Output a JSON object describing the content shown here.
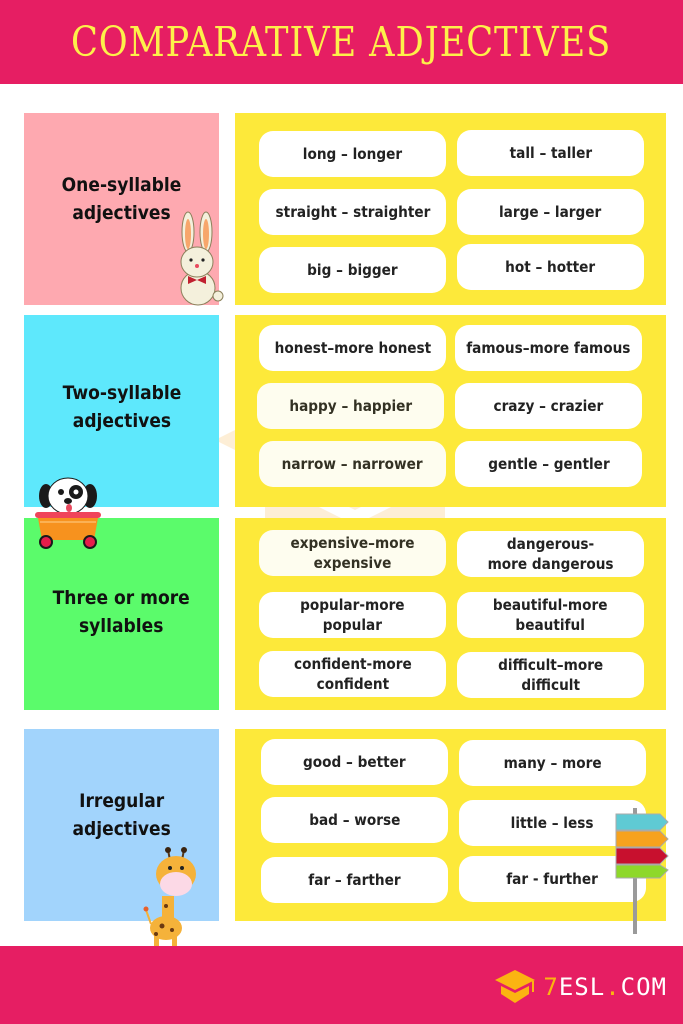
{
  "header": {
    "title": "COMPARATIVE ADJECTIVES"
  },
  "colors": {
    "brand_pink": "#e61e63",
    "title_yellow": "#fdf04a",
    "panel_yellow": "#fde93a",
    "one_syllable_bg": "#fea9b0",
    "two_syllable_bg": "#5ee8fc",
    "three_syllable_bg": "#5bfb6b",
    "irregular_bg": "#a2d4fc",
    "logo_accent": "#fbb411"
  },
  "sections": [
    {
      "label": "One-syllable\nadjectives",
      "items": [
        "long – longer",
        "tall – taller",
        "straight – straighter",
        "large – larger",
        "big – bigger",
        "hot – hotter"
      ]
    },
    {
      "label": "Two-syllable\nadjectives",
      "items": [
        "honest–more honest",
        "famous–more famous",
        "happy – happier",
        "crazy – crazier",
        "narrow – narrower",
        "gentle – gentler"
      ]
    },
    {
      "label": "Three or more\nsyllables",
      "items": [
        "expensive–more\nexpensive",
        "dangerous-\nmore dangerous",
        "popular-more\npopular",
        "beautiful-more\nbeautiful",
        "confident-more\nconfident",
        "difficult–more\ndifficult"
      ]
    },
    {
      "label": "Irregular\nadjectives",
      "items": [
        "good – better",
        "many – more",
        "bad – worse",
        "little – less",
        "far – farther",
        "far - further"
      ]
    }
  ],
  "illustrations": {
    "section_0": "rabbit-with-bowtie",
    "section_1": "dog-in-cart",
    "section_3_left": "giraffe",
    "section_3_right": "signpost"
  },
  "footer": {
    "logo_seven": "7",
    "logo_main": "ESL",
    "logo_dot": ".",
    "logo_tld": "COM",
    "logo_icon": "graduation-cap-icon"
  }
}
